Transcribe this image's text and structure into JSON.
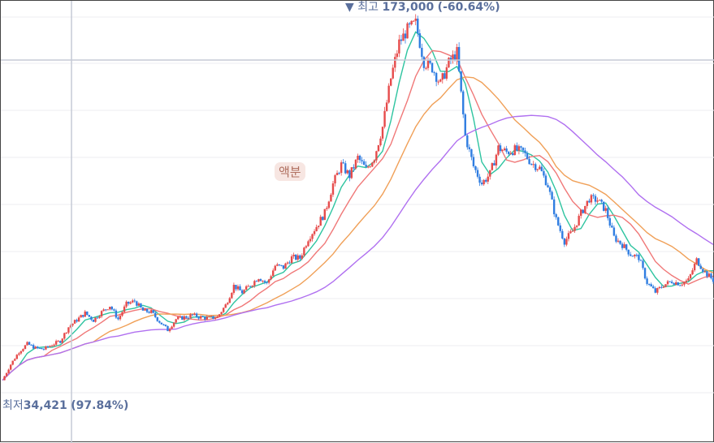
{
  "chart_data": {
    "type": "candlestick",
    "grid": true,
    "moving_averages": [
      {
        "id": "ma-short",
        "color": "#2ec4a0"
      },
      {
        "id": "ma-medium",
        "color": "#f07878"
      },
      {
        "id": "ma-long",
        "color": "#f0a058"
      },
      {
        "id": "ma-longest",
        "color": "#b070f0"
      }
    ],
    "candle_colors": {
      "up": "#e64b4b",
      "down": "#2f7de1"
    },
    "close_series": [
      35000,
      41000,
      45800,
      48800,
      47200,
      46800,
      48500,
      49900,
      55200,
      57900,
      60500,
      57800,
      60900,
      63300,
      58200,
      63900,
      65100,
      61400,
      60900,
      57300,
      54100,
      58200,
      58900,
      59700,
      58900,
      58600,
      59000,
      63500,
      70900,
      68400,
      71100,
      74200,
      71700,
      78500,
      77900,
      81600,
      81400,
      88900,
      93500,
      98600,
      109600,
      116900,
      112700,
      119600,
      115100,
      119800,
      131300,
      149800,
      163300,
      168200,
      170700,
      156000,
      153800,
      147600,
      155600,
      159600,
      127800,
      116300,
      109800,
      113400,
      123300,
      121700,
      122600,
      121700,
      117600,
      115600,
      109100,
      96000,
      87800,
      91700,
      98400,
      104000,
      103500,
      99600,
      89300,
      86500,
      82900,
      81600,
      72100,
      68500,
      71200,
      72600,
      71700,
      73000,
      80700,
      76000,
      73100
    ],
    "annotations": {
      "high": {
        "marker": "▼",
        "prefix": "최고",
        "value": "173,000",
        "change": "(-60.64%)"
      },
      "low": {
        "prefix": "최저",
        "value": "34,421",
        "change": "(97.84%)"
      },
      "event": "액분"
    },
    "ylim": [
      25000,
      178000
    ]
  }
}
